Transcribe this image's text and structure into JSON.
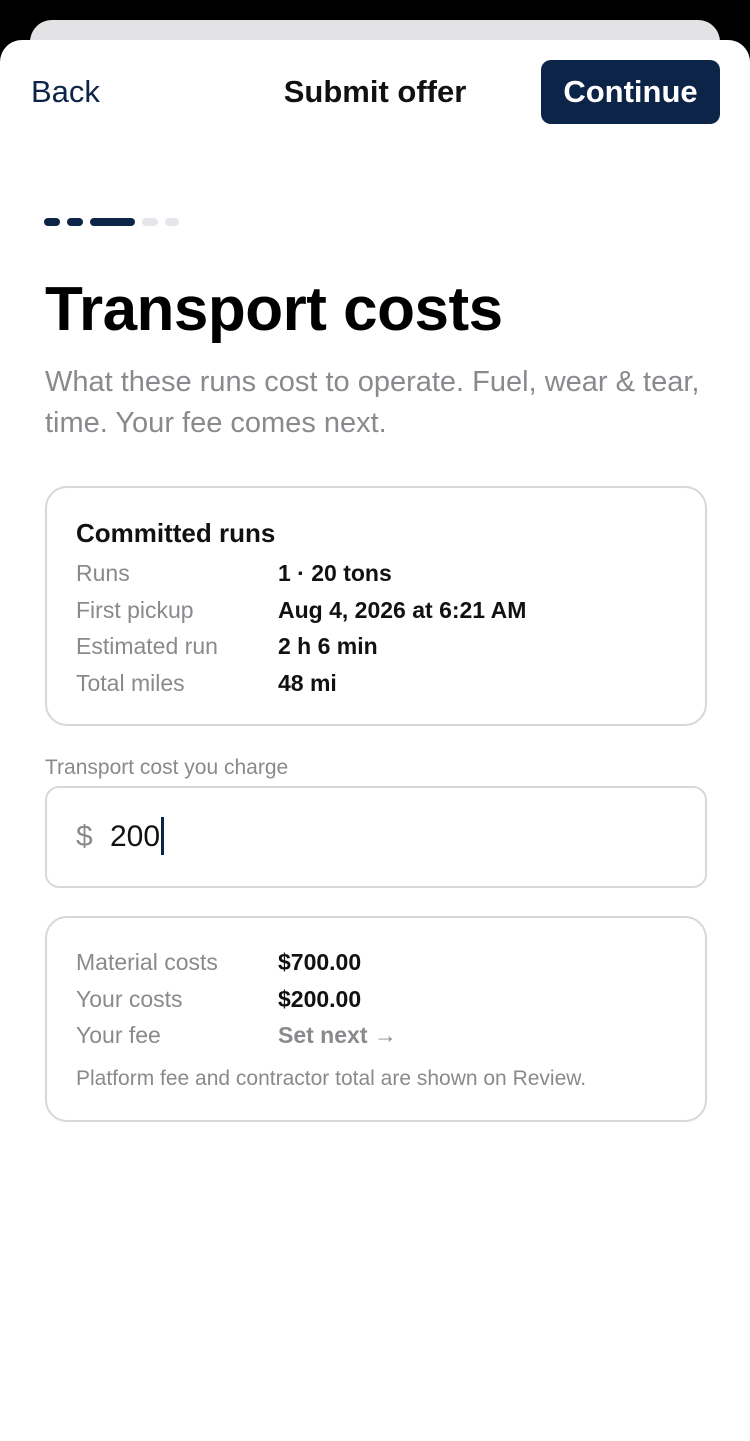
{
  "header": {
    "back_label": "Back",
    "title": "Submit offer",
    "continue_label": "Continue"
  },
  "progress": {
    "total_steps": 5,
    "current_step": 3,
    "active_color": "#0c2447",
    "inactive_color": "#e6e6ea"
  },
  "page": {
    "title": "Transport costs",
    "subtitle": "What these runs cost to operate. Fuel, wear & tear, time. Your fee comes next."
  },
  "committed_runs": {
    "title": "Committed runs",
    "rows": [
      {
        "label": "Runs",
        "value": "1 · 20 tons"
      },
      {
        "label": "First pickup",
        "value": "Aug 4, 2026 at 6:21 AM"
      },
      {
        "label": "Estimated run",
        "value": "2 h 6 min"
      },
      {
        "label": "Total miles",
        "value": "48 mi"
      }
    ]
  },
  "transport_cost": {
    "label": "Transport cost you charge",
    "currency_symbol": "$",
    "value": "200"
  },
  "summary": {
    "rows": [
      {
        "label": "Material costs",
        "value": "$700.00"
      },
      {
        "label": "Your costs",
        "value": "$200.00"
      },
      {
        "label": "Your fee",
        "value": "Set next →"
      }
    ],
    "footnote": "Platform fee and contractor total are shown on Review."
  },
  "colors": {
    "brand_navy": "#0c2447",
    "muted_text": "#8a8a8e",
    "border": "#d8d8dc"
  }
}
